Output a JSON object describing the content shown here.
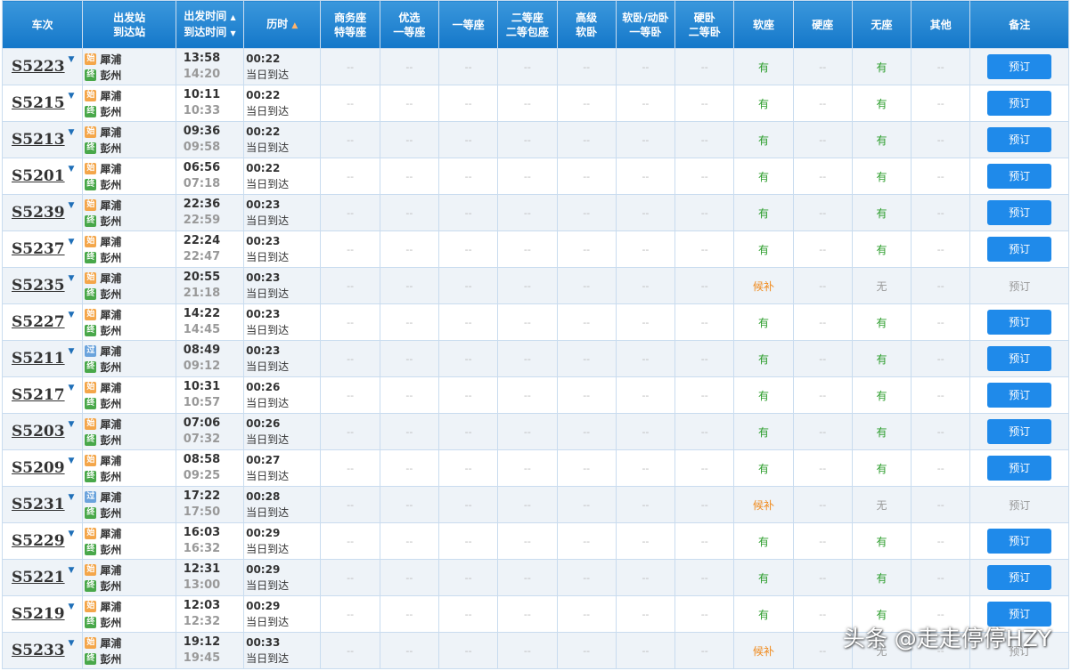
{
  "header": {
    "train": "车次",
    "dep_station": "出发站",
    "arr_station": "到达站",
    "dep_time": "出发时间",
    "arr_time": "到达时间",
    "duration": "历时",
    "business_1": "商务座",
    "business_2": "特等座",
    "premium_1": "优选",
    "premium_2": "一等座",
    "first": "一等座",
    "second_1": "二等座",
    "second_2": "二等包座",
    "superior_1": "高级",
    "superior_2": "软卧",
    "softsleep_1": "软卧/动卧",
    "softsleep_2": "一等卧",
    "hardsleep_1": "硬卧",
    "hardsleep_2": "二等卧",
    "softseat": "软座",
    "hardseat": "硬座",
    "noseat": "无座",
    "other": "其他",
    "remark": "备注"
  },
  "labels": {
    "dash": "--",
    "same_day": "当日到达",
    "book": "预订",
    "badge_start": "始",
    "badge_pass": "过",
    "badge_end": "终",
    "yes": "有",
    "no": "无",
    "waitlist": "候补"
  },
  "rows": [
    {
      "train": "S5223",
      "from": "犀浦",
      "from_type": "start",
      "to": "彭州",
      "dep": "13:58",
      "arr": "14:20",
      "dur": "00:22",
      "soft": "有",
      "none": "有",
      "bookable": true
    },
    {
      "train": "S5215",
      "from": "犀浦",
      "from_type": "start",
      "to": "彭州",
      "dep": "10:11",
      "arr": "10:33",
      "dur": "00:22",
      "soft": "有",
      "none": "有",
      "bookable": true
    },
    {
      "train": "S5213",
      "from": "犀浦",
      "from_type": "start",
      "to": "彭州",
      "dep": "09:36",
      "arr": "09:58",
      "dur": "00:22",
      "soft": "有",
      "none": "有",
      "bookable": true
    },
    {
      "train": "S5201",
      "from": "犀浦",
      "from_type": "start",
      "to": "彭州",
      "dep": "06:56",
      "arr": "07:18",
      "dur": "00:22",
      "soft": "有",
      "none": "有",
      "bookable": true
    },
    {
      "train": "S5239",
      "from": "犀浦",
      "from_type": "start",
      "to": "彭州",
      "dep": "22:36",
      "arr": "22:59",
      "dur": "00:23",
      "soft": "有",
      "none": "有",
      "bookable": true
    },
    {
      "train": "S5237",
      "from": "犀浦",
      "from_type": "start",
      "to": "彭州",
      "dep": "22:24",
      "arr": "22:47",
      "dur": "00:23",
      "soft": "有",
      "none": "有",
      "bookable": true
    },
    {
      "train": "S5235",
      "from": "犀浦",
      "from_type": "start",
      "to": "彭州",
      "dep": "20:55",
      "arr": "21:18",
      "dur": "00:23",
      "soft": "候补",
      "none": "无",
      "bookable": false
    },
    {
      "train": "S5227",
      "from": "犀浦",
      "from_type": "start",
      "to": "彭州",
      "dep": "14:22",
      "arr": "14:45",
      "dur": "00:23",
      "soft": "有",
      "none": "有",
      "bookable": true
    },
    {
      "train": "S5211",
      "from": "犀浦",
      "from_type": "pass",
      "to": "彭州",
      "dep": "08:49",
      "arr": "09:12",
      "dur": "00:23",
      "soft": "有",
      "none": "有",
      "bookable": true
    },
    {
      "train": "S5217",
      "from": "犀浦",
      "from_type": "start",
      "to": "彭州",
      "dep": "10:31",
      "arr": "10:57",
      "dur": "00:26",
      "soft": "有",
      "none": "有",
      "bookable": true
    },
    {
      "train": "S5203",
      "from": "犀浦",
      "from_type": "start",
      "to": "彭州",
      "dep": "07:06",
      "arr": "07:32",
      "dur": "00:26",
      "soft": "有",
      "none": "有",
      "bookable": true
    },
    {
      "train": "S5209",
      "from": "犀浦",
      "from_type": "start",
      "to": "彭州",
      "dep": "08:58",
      "arr": "09:25",
      "dur": "00:27",
      "soft": "有",
      "none": "有",
      "bookable": true
    },
    {
      "train": "S5231",
      "from": "犀浦",
      "from_type": "pass",
      "to": "彭州",
      "dep": "17:22",
      "arr": "17:50",
      "dur": "00:28",
      "soft": "候补",
      "none": "无",
      "bookable": false
    },
    {
      "train": "S5229",
      "from": "犀浦",
      "from_type": "start",
      "to": "彭州",
      "dep": "16:03",
      "arr": "16:32",
      "dur": "00:29",
      "soft": "有",
      "none": "有",
      "bookable": true
    },
    {
      "train": "S5221",
      "from": "犀浦",
      "from_type": "start",
      "to": "彭州",
      "dep": "12:31",
      "arr": "13:00",
      "dur": "00:29",
      "soft": "有",
      "none": "有",
      "bookable": true
    },
    {
      "train": "S5219",
      "from": "犀浦",
      "from_type": "start",
      "to": "彭州",
      "dep": "12:03",
      "arr": "12:32",
      "dur": "00:29",
      "soft": "有",
      "none": "有",
      "bookable": true
    },
    {
      "train": "S5233",
      "from": "犀浦",
      "from_type": "start",
      "to": "彭州",
      "dep": "19:12",
      "arr": "19:45",
      "dur": "00:33",
      "soft": "候补",
      "none": "无",
      "bookable": false
    }
  ],
  "watermark": "头条 @走走停停HZY",
  "colors": {
    "header": "#1f82d2",
    "book_button": "#1f8aea",
    "available": "#2a9c2a",
    "waitlist": "#f08a1c",
    "badge_start": "#f4a64a",
    "badge_pass": "#6aa3dc",
    "badge_end": "#49a84a"
  }
}
